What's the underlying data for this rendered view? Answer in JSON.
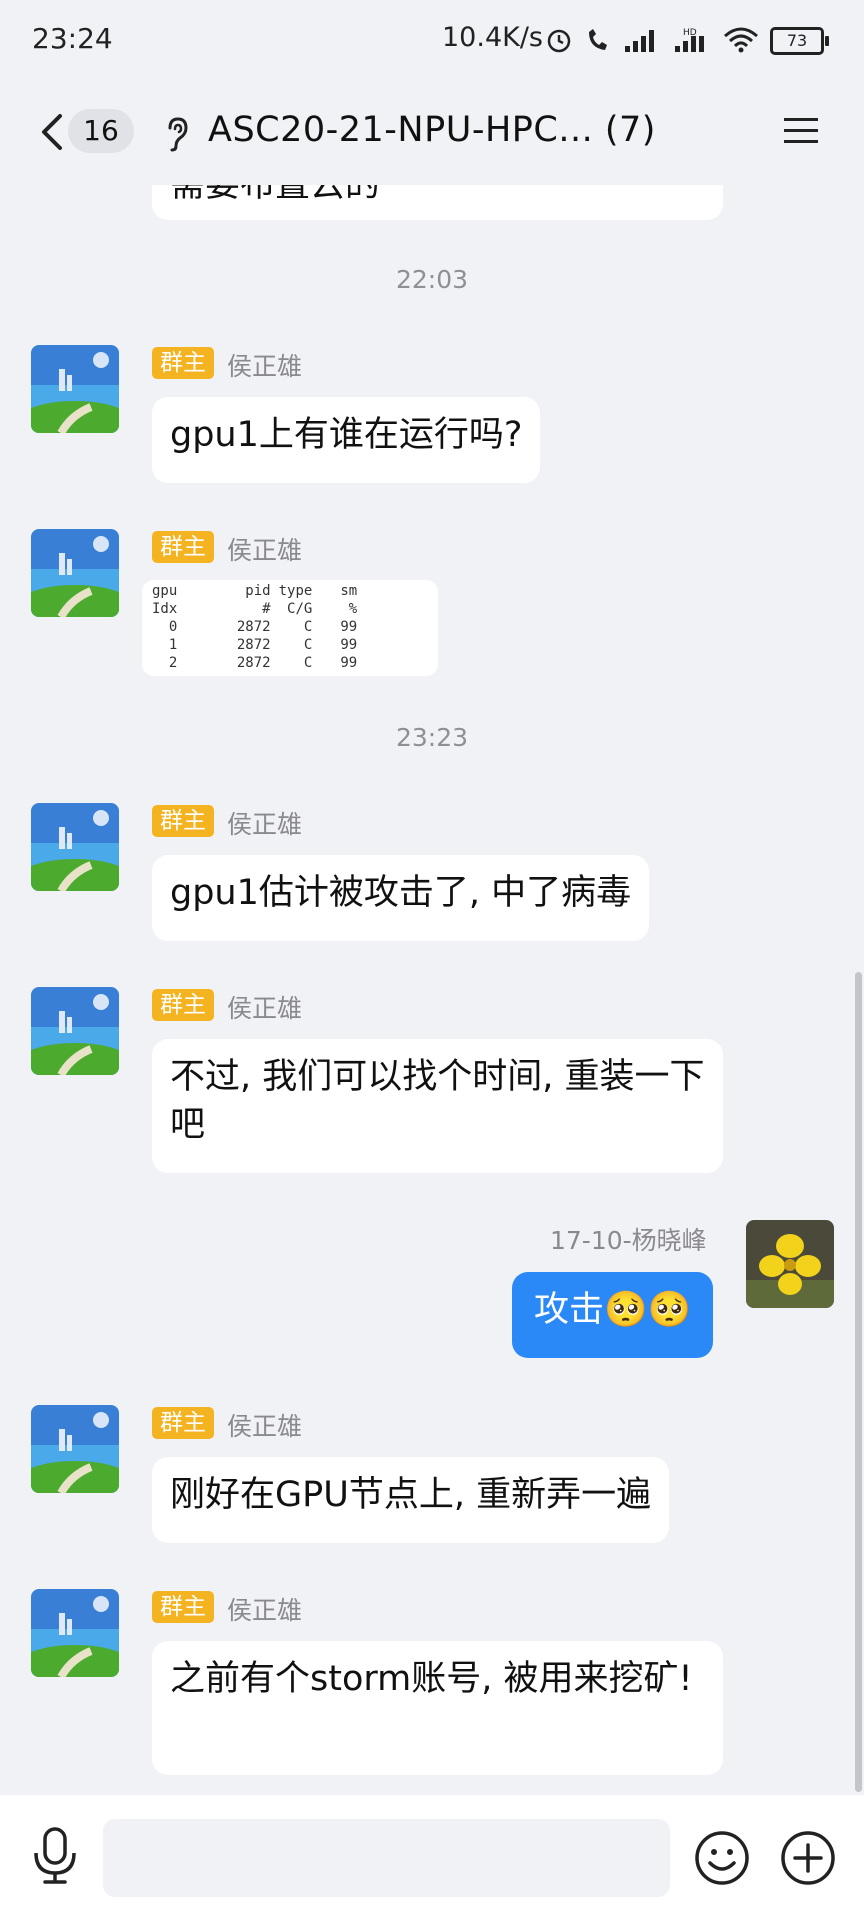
{
  "status": {
    "time": "23:24",
    "net_speed": "10.4K/s",
    "battery": "73"
  },
  "header": {
    "unread_count": "16",
    "title": "ASC20-21-NPU-HPC... (7)"
  },
  "partial_message": {
    "text": "需要布置云的"
  },
  "timestamps": [
    "22:03",
    "23:23"
  ],
  "messages": [
    {
      "badge": "群主",
      "sender": "侯正雄",
      "text": "gpu1上有谁在运行吗?"
    },
    {
      "badge": "群主",
      "sender": "侯正雄"
    },
    {
      "badge": "群主",
      "sender": "侯正雄",
      "text": "gpu1估计被攻击了, 中了病毒"
    },
    {
      "badge": "群主",
      "sender": "侯正雄",
      "text": "不过, 我们可以找个时间, 重装一下吧"
    },
    {
      "sender": "17-10-杨晓峰",
      "text": "攻击🥺🥺"
    },
    {
      "badge": "群主",
      "sender": "侯正雄",
      "text": "刚好在GPU节点上, 重新弄一遍"
    },
    {
      "badge": "群主",
      "sender": "侯正雄",
      "text": "之前有个storm账号, 被用来挖矿!"
    }
  ],
  "gpu_table": {
    "headers": [
      "gpu",
      "pid",
      "type",
      "sm"
    ],
    "subheaders": [
      "Idx",
      "#",
      "C/G",
      "%"
    ],
    "rows": [
      [
        "0",
        "2872",
        "C",
        "99"
      ],
      [
        "1",
        "2872",
        "C",
        "99"
      ],
      [
        "2",
        "2872",
        "C",
        "99"
      ]
    ]
  },
  "input": {
    "value": ""
  },
  "colors": {
    "accent": "#2b89f7",
    "badge": "#f4b320",
    "background": "#f1f2f6"
  }
}
